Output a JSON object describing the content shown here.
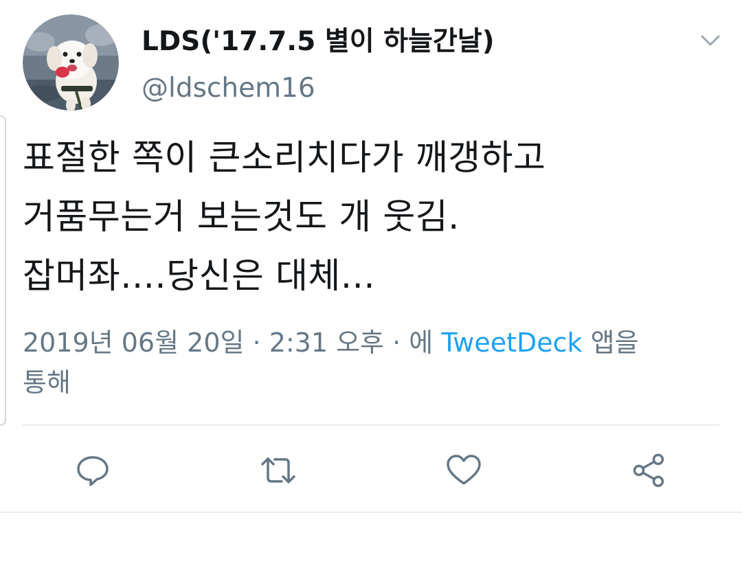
{
  "user": {
    "display_name": "LDS('17.7.5 별이 하늘간날)",
    "handle": "@ldschem16",
    "avatar_icon": "dog-avatar-photo"
  },
  "tweet": {
    "lines": [
      "표절한 쪽이 큰소리치다가 깨갱하고",
      "거품무는거 보는것도 개 웃김.",
      "잡머좌....당신은 대체..."
    ]
  },
  "meta": {
    "timestamp": "2019년 06월 20일 · 2:31 오후 · 에",
    "source": "TweetDeck",
    "source_suffix": "앱을",
    "source_suffix_line2": "통해"
  },
  "actions": {
    "reply_icon": "reply-icon",
    "retweet_icon": "retweet-icon",
    "like_icon": "heart-icon",
    "share_icon": "share-icon"
  },
  "colors": {
    "text_primary": "#14171a",
    "text_secondary": "#657786",
    "link": "#1da1f2",
    "divider": "#e6ecf0",
    "icon": "#657786"
  }
}
